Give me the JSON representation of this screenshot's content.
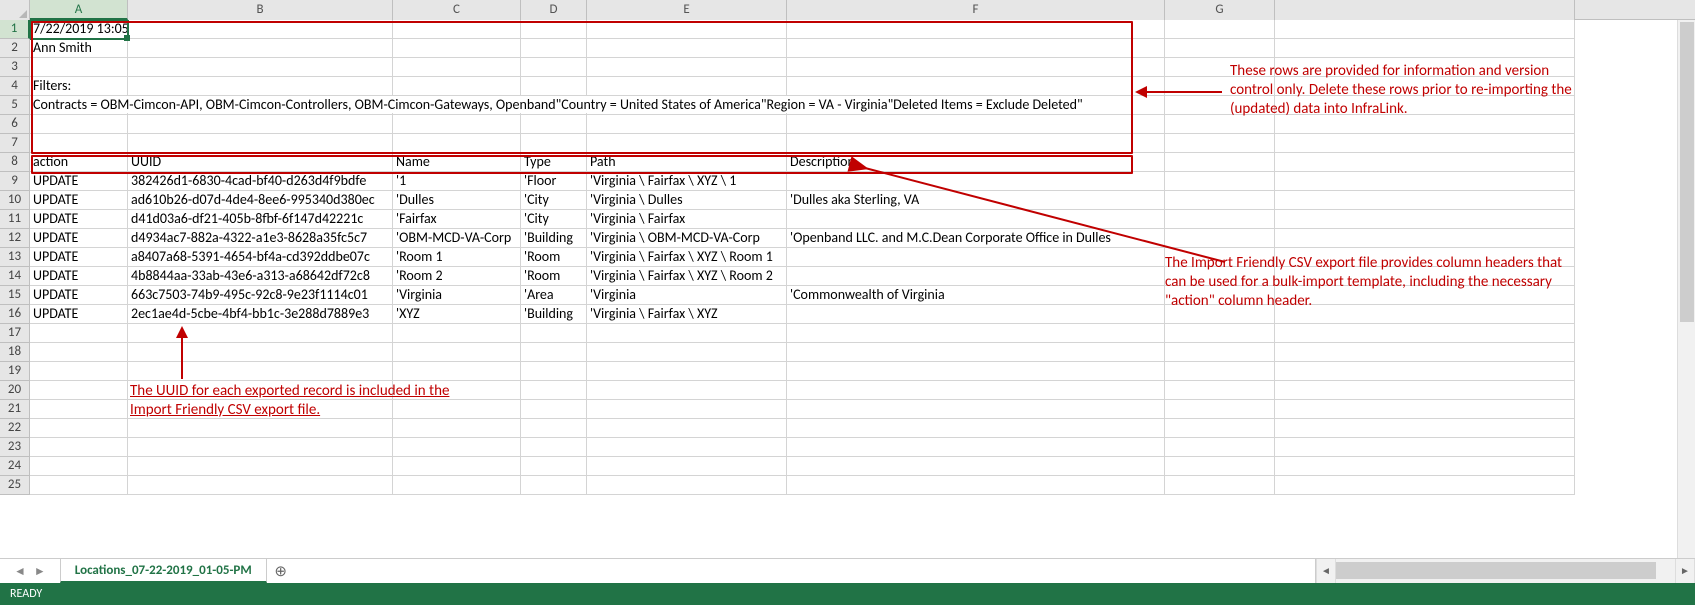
{
  "columns": [
    "A",
    "B",
    "C",
    "D",
    "E",
    "F",
    "G"
  ],
  "row_count": 25,
  "active_cell": {
    "row": 1,
    "col": "A"
  },
  "sheet_tab": "Locations_07-22-2019_01-05-PM",
  "status": "READY",
  "info_rows": {
    "r1": {
      "A": "7/22/2019 13:05"
    },
    "r2": {
      "A": "Ann Smith"
    },
    "r4": {
      "A": "Filters:"
    },
    "r5": {
      "A": "Contracts = OBM-Cimcon-API, OBM-Cimcon-Controllers, OBM-Cimcon-Gateways, Openband\"Country = United States of America\"Region = VA - Virginia\"Deleted Items = Exclude Deleted\""
    }
  },
  "headers": {
    "A": "action",
    "B": "UUID",
    "C": "Name",
    "D": "Type",
    "E": "Path",
    "F": "Description"
  },
  "data_rows": [
    {
      "A": "UPDATE",
      "B": "382426d1-6830-4cad-bf40-d263d4f9bdfe",
      "C": "'1",
      "D": "'Floor",
      "E": "'Virginia \\ Fairfax \\ XYZ \\ 1",
      "F": ""
    },
    {
      "A": "UPDATE",
      "B": "ad610b26-d07d-4de4-8ee6-995340d380ec",
      "C": "'Dulles",
      "D": "'City",
      "E": "'Virginia \\ Dulles",
      "F": "'Dulles aka Sterling, VA"
    },
    {
      "A": "UPDATE",
      "B": "d41d03a6-df21-405b-8fbf-6f147d42221c",
      "C": "'Fairfax",
      "D": "'City",
      "E": "'Virginia \\ Fairfax",
      "F": ""
    },
    {
      "A": "UPDATE",
      "B": "d4934ac7-882a-4322-a1e3-8628a35fc5c7",
      "C": "'OBM-MCD-VA-Corp",
      "D": "'Building",
      "E": "'Virginia \\ OBM-MCD-VA-Corp",
      "F": "'Openband LLC. and M.C.Dean Corporate Office in Dulles"
    },
    {
      "A": "UPDATE",
      "B": "a8407a68-5391-4654-bf4a-cd392ddbe07c",
      "C": "'Room 1",
      "D": "'Room",
      "E": "'Virginia \\ Fairfax \\ XYZ \\ Room 1",
      "F": ""
    },
    {
      "A": "UPDATE",
      "B": "4b8844aa-33ab-43e6-a313-a68642df72c8",
      "C": "'Room 2",
      "D": "'Room",
      "E": "'Virginia \\ Fairfax \\ XYZ \\ Room 2",
      "F": ""
    },
    {
      "A": "UPDATE",
      "B": "663c7503-74b9-495c-92c8-9e23f1114c01",
      "C": "'Virginia",
      "D": "'Area",
      "E": "'Virginia",
      "F": "'Commonwealth of Virginia"
    },
    {
      "A": "UPDATE",
      "B": "2ec1ae4d-5cbe-4bf4-bb1c-3e288d7889e3",
      "C": "'XYZ",
      "D": "'Building",
      "E": "'Virginia \\ Fairfax \\ XYZ",
      "F": ""
    }
  ],
  "annotations": {
    "note1": "These rows are provided for information and version control only. Delete these rows prior to re-importing the (updated) data into InfraLink.",
    "note2": "The Import Friendly CSV export file provides column headers that can be used for a bulk-import template, including the necessary \"action\" column header.",
    "note3": "The UUID for each exported record is included in the Import Friendly CSV export file."
  }
}
